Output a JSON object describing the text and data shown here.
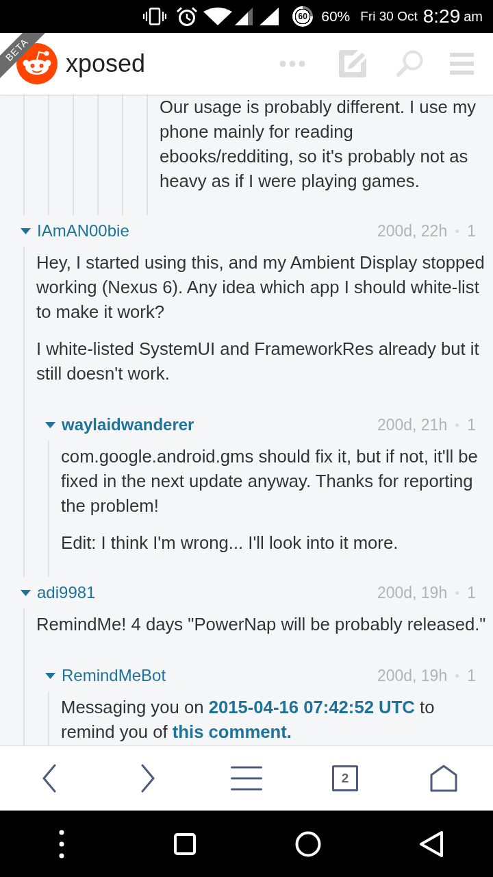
{
  "status_bar": {
    "battery_ring": "60",
    "battery": "60%",
    "date": "Fri 30 Oct",
    "time": "8:29",
    "meridiem": "am"
  },
  "header": {
    "badge": "BETA",
    "title": "xposed"
  },
  "comments": [
    {
      "children": [
        {
          "children": [
            {
              "children": [
                {
                  "children": [
                    {
                      "children": [
                        {
                          "paragraphs": [
                            [
                              {
                                "kind": "text",
                                "text": "Our usage is probably different. I use my phone mainly for reading ebooks/redditing, so it's probably not as heavy as if I were playing games."
                              }
                            ]
                          ]
                        }
                      ]
                    }
                  ]
                }
              ]
            }
          ]
        }
      ]
    },
    {
      "author": "IAmAN00bie",
      "submitter": false,
      "expanded": true,
      "age": "200d, 22h",
      "points": "1",
      "paragraphs": [
        [
          {
            "kind": "text",
            "text": "Hey, I started using this, and my Ambient Display stopped working (Nexus 6). Any idea which app I should white-list to make it work?"
          }
        ],
        [
          {
            "kind": "text",
            "text": "I white-listed SystemUI and FrameworkRes already but it still doesn't work."
          }
        ]
      ],
      "children": [
        {
          "author": "waylaidwanderer",
          "submitter": true,
          "expanded": true,
          "age": "200d, 21h",
          "points": "1",
          "paragraphs": [
            [
              {
                "kind": "text",
                "text": "com.google.android.gms should fix it, but if not, it'll be fixed in the next update anyway. Thanks for reporting the problem!"
              }
            ],
            [
              {
                "kind": "text",
                "text": "Edit: I think I'm wrong... I'll look into it more."
              }
            ]
          ]
        }
      ]
    },
    {
      "author": "adi9981",
      "submitter": false,
      "expanded": true,
      "age": "200d, 19h",
      "points": "1",
      "paragraphs": [
        [
          {
            "kind": "text",
            "text": "RemindMe! 4 days \"PowerNap will be probably released.\""
          }
        ]
      ],
      "children": [
        {
          "author": "RemindMeBot",
          "submitter": false,
          "expanded": true,
          "age": "200d, 19h",
          "points": "1",
          "paragraphs": [
            [
              {
                "kind": "text",
                "text": "Messaging you on "
              },
              {
                "kind": "link",
                "text": "2015-04-16 07:42:52 UTC"
              },
              {
                "kind": "text",
                "text": " to remind you of "
              },
              {
                "kind": "link",
                "text": "this comment."
              }
            ]
          ]
        }
      ]
    }
  ],
  "bottom_nav": {
    "tab_count": "2"
  }
}
